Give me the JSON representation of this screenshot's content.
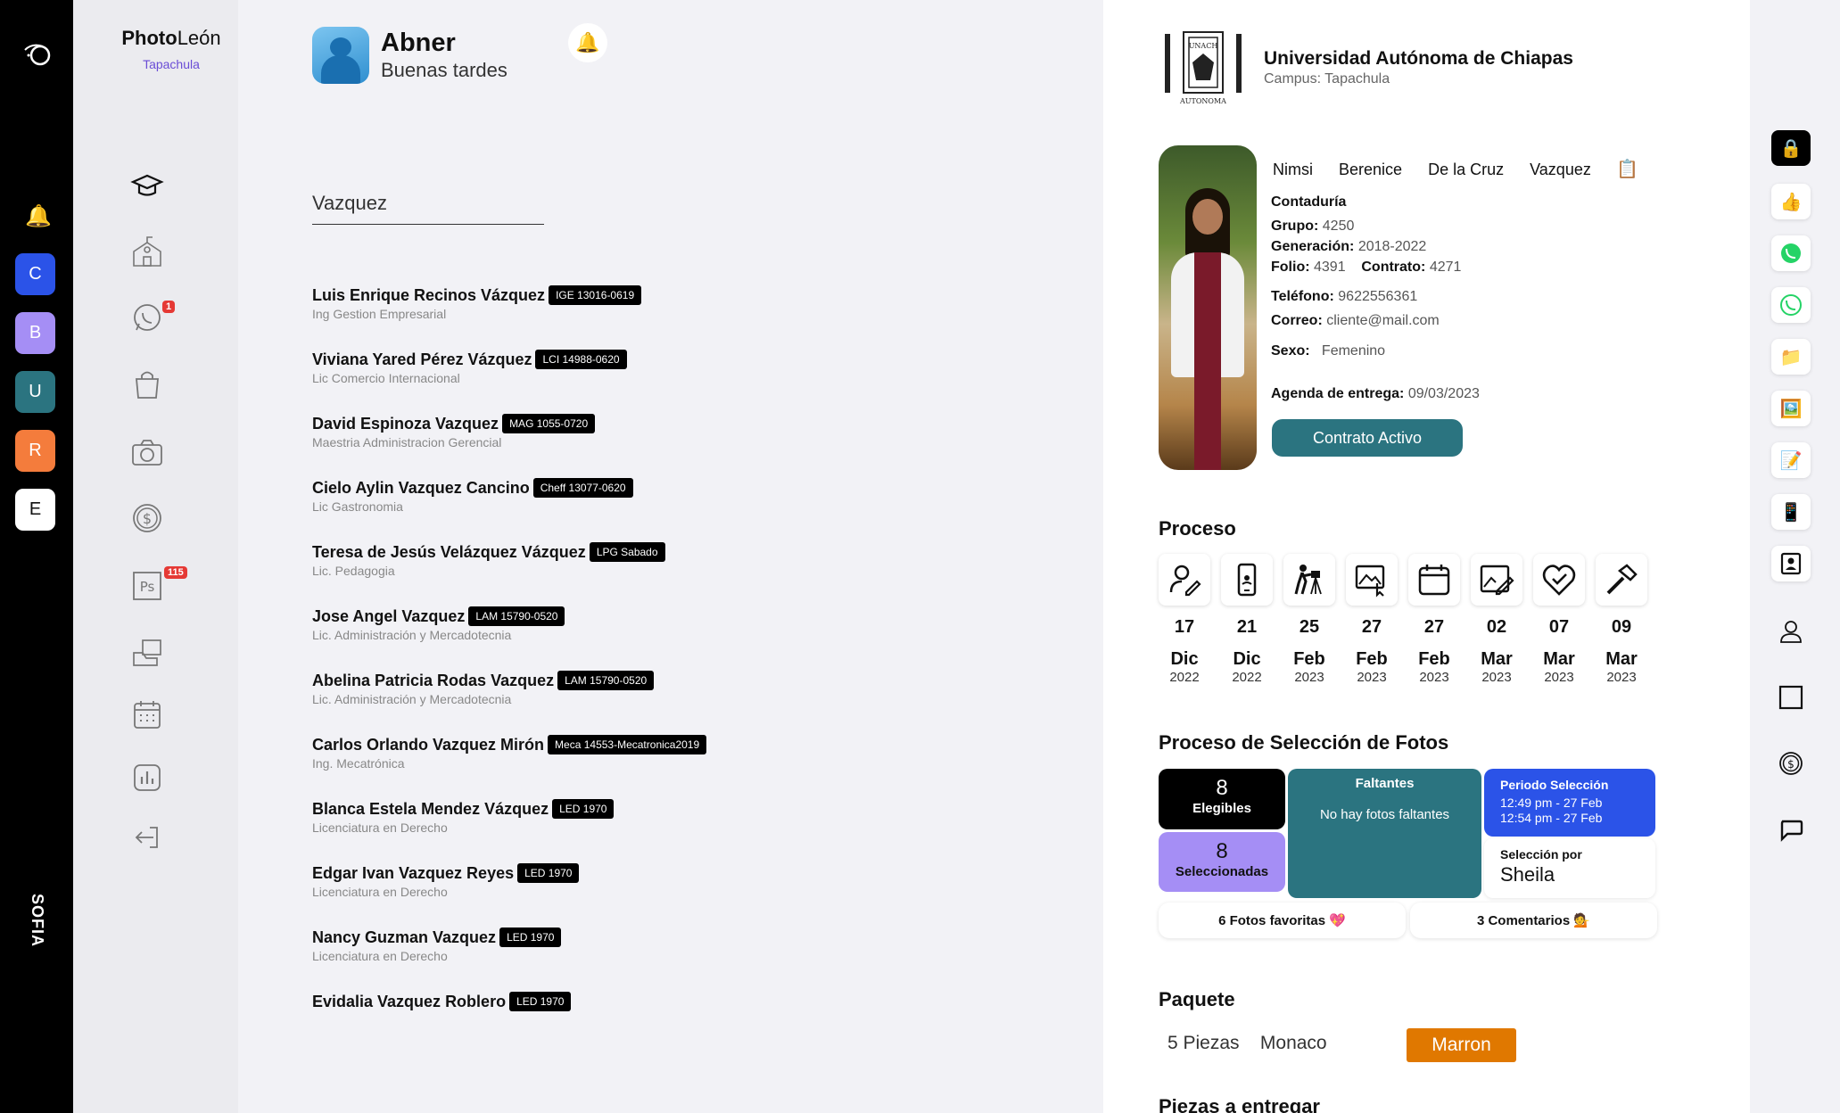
{
  "app": {
    "brand_bold": "Photo",
    "brand_rest": "León",
    "branch": "Tapachula",
    "rail_label": "SOFIA"
  },
  "workspaces": [
    {
      "letter": "C",
      "color": "#2b53e8"
    },
    {
      "letter": "B",
      "color": "#a58ef5"
    },
    {
      "letter": "U",
      "color": "#2b7480"
    },
    {
      "letter": "R",
      "color": "#f47c3c"
    },
    {
      "letter": "E",
      "color": "#ffffff"
    }
  ],
  "nav": {
    "whatsapp_badge": "1",
    "ps_badge": "115"
  },
  "user": {
    "name": "Abner",
    "greeting": "Buenas tardes"
  },
  "search": {
    "value": "Vazquez"
  },
  "results": [
    {
      "name": "Luis Enrique Recinos Vázquez",
      "tag": "IGE 13016-0619",
      "program": "Ing Gestion Empresarial"
    },
    {
      "name": "Viviana Yared Pérez Vázquez",
      "tag": "LCI 14988-0620",
      "program": "Lic Comercio Internacional"
    },
    {
      "name": "David Espinoza Vazquez",
      "tag": "MAG 1055-0720",
      "program": "Maestria Administracion Gerencial"
    },
    {
      "name": "Cielo Aylin Vazquez Cancino",
      "tag": "Cheff 13077-0620",
      "program": "Lic Gastronomia"
    },
    {
      "name": "Teresa de Jesús Velázquez Vázquez",
      "tag": "LPG Sabado",
      "program": "Lic. Pedagogia"
    },
    {
      "name": "Jose Angel Vazquez",
      "tag": "LAM 15790-0520",
      "program": "Lic. Administración y Mercadotecnia"
    },
    {
      "name": "Abelina Patricia Rodas Vazquez",
      "tag": "LAM 15790-0520",
      "program": "Lic. Administración y Mercadotecnia"
    },
    {
      "name": "Carlos Orlando Vazquez Mirón",
      "tag": "Meca 14553-Mecatronica2019",
      "program": "Ing. Mecatrónica"
    },
    {
      "name": "Blanca Estela Mendez Vázquez",
      "tag": "LED 1970",
      "program": "Licenciatura en Derecho"
    },
    {
      "name": "Edgar Ivan Vazquez Reyes",
      "tag": "LED 1970",
      "program": "Licenciatura en Derecho"
    },
    {
      "name": "Nancy Guzman Vazquez",
      "tag": "LED 1970",
      "program": "Licenciatura en Derecho"
    },
    {
      "name": "Evidalia Vazquez Roblero",
      "tag": "LED 1970",
      "program": ""
    }
  ],
  "university": {
    "name": "Universidad Autónoma de Chiapas",
    "campus": "Campus: Tapachula"
  },
  "student": {
    "first": "Nimsi",
    "second": "Berenice",
    "last1": "De la Cruz",
    "last2": "Vazquez",
    "career": "Contaduría",
    "grupo_label": "Grupo:",
    "grupo": "4250",
    "gen_label": "Generación:",
    "gen": "2018-2022",
    "folio_label": "Folio:",
    "folio": "4391",
    "contrato_label": "Contrato:",
    "contrato": "4271",
    "tel_label": "Teléfono:",
    "tel": "9622556361",
    "mail_label": "Correo:",
    "mail": "cliente@mail.com",
    "sexo_label": "Sexo:",
    "sexo": "Femenino",
    "agenda_label": "Agenda de entrega:",
    "agenda": "09/03/2023",
    "status_button": "Contrato Activo"
  },
  "proceso": {
    "title": "Proceso",
    "steps": [
      {
        "icon": "user-edit-icon",
        "day": "17",
        "month": "Dic",
        "year": "2022"
      },
      {
        "icon": "phone-icon",
        "day": "21",
        "month": "Dic",
        "year": "2022"
      },
      {
        "icon": "photographer-icon",
        "day": "25",
        "month": "Feb",
        "year": "2023"
      },
      {
        "icon": "image-select-icon",
        "day": "27",
        "month": "Feb",
        "year": "2023"
      },
      {
        "icon": "calendar-icon",
        "day": "27",
        "month": "Feb",
        "year": "2023"
      },
      {
        "icon": "image-edit-icon",
        "day": "02",
        "month": "Mar",
        "year": "2023"
      },
      {
        "icon": "heart-check-icon",
        "day": "07",
        "month": "Mar",
        "year": "2023"
      },
      {
        "icon": "hammer-icon",
        "day": "09",
        "month": "Mar",
        "year": "2023"
      }
    ]
  },
  "seleccion": {
    "title": "Proceso de Selección de Fotos",
    "elegibles_num": "8",
    "elegibles_label": "Elegibles",
    "seleccionadas_num": "8",
    "seleccionadas_label": "Seleccionadas",
    "faltantes_title": "Faltantes",
    "faltantes_text": "No hay fotos faltantes",
    "periodo_title": "Periodo Selección",
    "periodo_start": "12:49 pm - 27 Feb",
    "periodo_end": "12:54 pm - 27 Feb",
    "por_label": "Selección por",
    "por_name": "Sheila",
    "favoritas": "6 Fotos favoritas 💖",
    "comentarios": "3 Comentarios 💁"
  },
  "paquete": {
    "title": "Paquete",
    "piezas": "5 Piezas",
    "modelo": "Monaco",
    "color": "Marron"
  },
  "piezas_title": "Piezas a entregar"
}
